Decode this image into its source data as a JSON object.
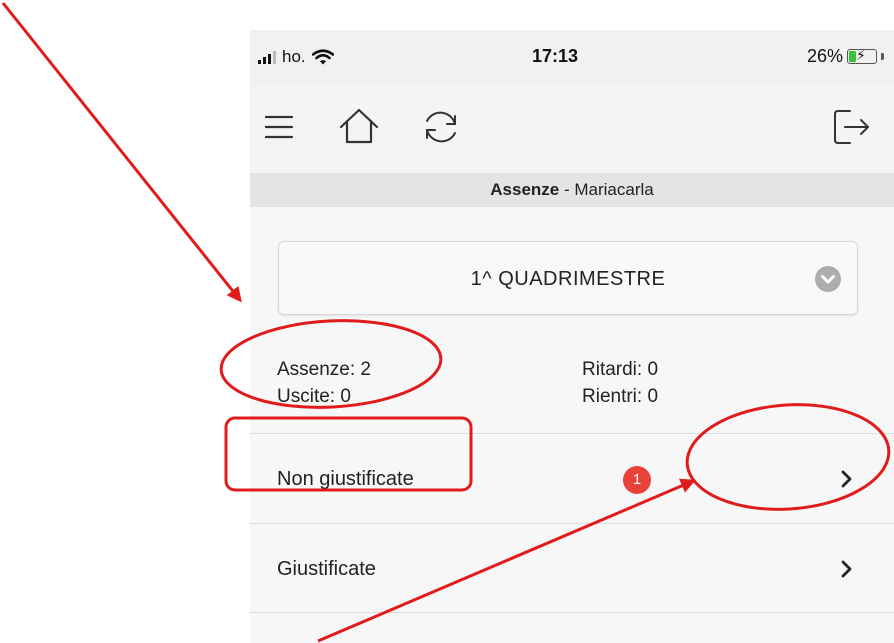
{
  "status_bar": {
    "carrier": "ho.",
    "time": "17:13",
    "battery": "26%",
    "battery_level": 0.26
  },
  "toolbar": {
    "menu_icon": "hamburger-menu-icon",
    "home_icon": "home-icon",
    "refresh_icon": "refresh-icon",
    "logout_icon": "logout-icon"
  },
  "header": {
    "section": "Assenze",
    "separator": " - ",
    "student": "Mariacarla"
  },
  "period_select": {
    "value": "1^ QUADRIMESTRE",
    "icon": "chevron-down-circle-icon"
  },
  "summary": {
    "absences": "Assenze: 2",
    "exits": "Uscite: 0",
    "delays": "Ritardi: 0",
    "returns": "Rientri: 0"
  },
  "list": {
    "items": [
      {
        "label": "Non giustificate",
        "badge": "1"
      },
      {
        "label": "Giustificate"
      }
    ]
  },
  "colors": {
    "annotation": "#e11b1b",
    "badge": "#e8423b",
    "battery_fill": "#3cc13b"
  }
}
